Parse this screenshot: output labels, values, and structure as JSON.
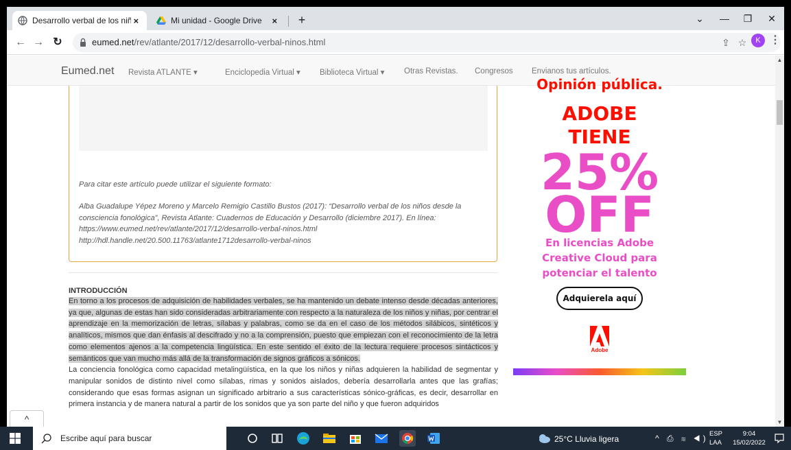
{
  "tabs": [
    {
      "title": "Desarrollo verbal de los niños de",
      "close": "×"
    },
    {
      "title": "Mi unidad - Google Drive",
      "close": "×"
    }
  ],
  "new_tab": "+",
  "window_controls": {
    "dropdown": "⌄",
    "minimize": "—",
    "maximize": "❐",
    "close": "✕"
  },
  "address_bar": {
    "host": "eumed.net",
    "path": "/rev/atlante/2017/12/desarrollo-verbal-ninos.html"
  },
  "profile_initial": "K",
  "site_nav": {
    "brand": "Eumed.net",
    "items": [
      "Revista ATLANTE ▾",
      "Enciclopedia Virtual ▾",
      "Biblioteca Virtual ▾",
      "Otras Revistas.",
      "Congresos",
      "Envianos tus artículos."
    ]
  },
  "citation": {
    "intro": "Para citar este artículo puede utilizar el siguiente formato:",
    "lines": [
      "Alba Guadalupe Yépez Moreno y Marcelo Remigio Castillo Bustos (2017): “Desarrollo verbal de los niños desde la",
      "consciencia fonológica”, Revista Atlante: Cuadernos de Educación y Desarrollo (diciembre 2017). En línea:",
      "https://www.eumed.net/rev/atlante/2017/12/desarrollo-verbal-ninos.html",
      "http://hdl.handle.net/20.500.11763/atlante1712desarrollo-verbal-ninos"
    ]
  },
  "intro_heading": "INTRODUCCIÓN",
  "body": {
    "highlighted": "En torno a los procesos de adquisición de habilidades verbales, se ha mantenido un debate intenso desde décadas anteriores, ya que, algunas de estas han sido consideradas  arbitrariamente con respecto a la naturaleza de los niños y niñas, por centrar  el aprendizaje en la memorización de letras, sílabas y  palabras,  como se da en el caso de los métodos silábicos, sintéticos y analíticos, mismos que dan énfasis al descifrado y no a  la comprensión, puesto que empiezan con el reconocimiento de la letra como elementos ajenos a la competencia lingüística. En este sentido el éxito de la  lectura requiere procesos sintácticos y semánticos que van mucho más allá de la transformación de signos gráficos a sónicos.",
    "paragraph2": "La conciencia fonológica como capacidad metalingüística, en la que los niños y niñas adquieren la habilidad de segmentar y manipular sonidos de distinto nivel como sílabas, rimas y sonidos aislados, debería desarrollarla antes que las grafías; considerando que esas formas asignan un significado arbitrario a sus características sónico-gráficas, es decir, desarrollar en  primera instancia y de manera natural a partir de los sonidos que ya son parte  del niño y que fueron adquiridos"
  },
  "ad": {
    "top_partial": "Opinión pública.",
    "line1": "ADOBE",
    "line2": "TIENE",
    "percent": "25%",
    "off": "OFF",
    "subtitle_lines": [
      "En licencias Adobe",
      "Creative Cloud para",
      "potenciar el talento"
    ],
    "button": "Adquierela aquí",
    "logo_text": "Adobe",
    "colors": {
      "red": "#fa0f00",
      "pink": "#e94ec7"
    }
  },
  "back_to_top": "^",
  "taskbar": {
    "search_placeholder": "Escribe aquí para buscar",
    "weather": "25°C  Lluvia ligera",
    "tray_symbols": "^ ⎙ ≋ ◀)",
    "lang_line1": "ESP",
    "lang_line2": "LAA",
    "time": "9:04",
    "date": "15/02/2022"
  }
}
